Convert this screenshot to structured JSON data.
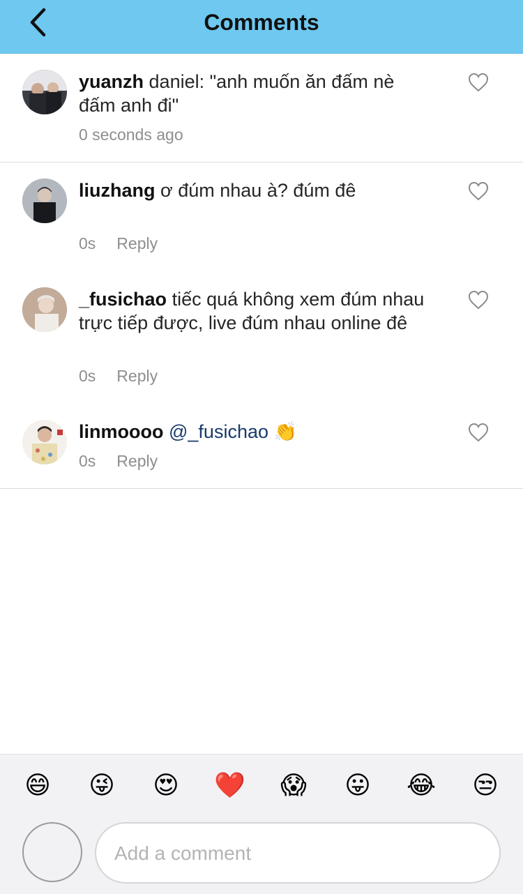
{
  "header": {
    "title": "Comments"
  },
  "comments": [
    {
      "username": "yuanzh",
      "text": "daniel: \"anh muốn ăn đấm nè đấm anh đi\"",
      "time": "0 seconds ago",
      "reply": ""
    },
    {
      "username": "liuzhang",
      "text": "ơ đúm nhau à? đúm đê",
      "time": "0s",
      "reply": "Reply"
    },
    {
      "username": "_fusichao",
      "text": "tiếc quá không xem đúm nhau trực tiếp được, live đúm nhau online đê",
      "time": "0s",
      "reply": "Reply"
    },
    {
      "username": "linmoooo",
      "mention": "@_fusichao",
      "text": "👏",
      "time": "0s",
      "reply": "Reply"
    }
  ],
  "emoji_bar": [
    "😄",
    "😜",
    "😍",
    "❤️",
    "😱",
    "😛",
    "😂",
    "😒"
  ],
  "composer": {
    "placeholder": "Add a comment"
  },
  "colors": {
    "header_bg": "#6ec8f0",
    "mention": "#1a3a6b",
    "muted_text": "#8e8e8e"
  }
}
